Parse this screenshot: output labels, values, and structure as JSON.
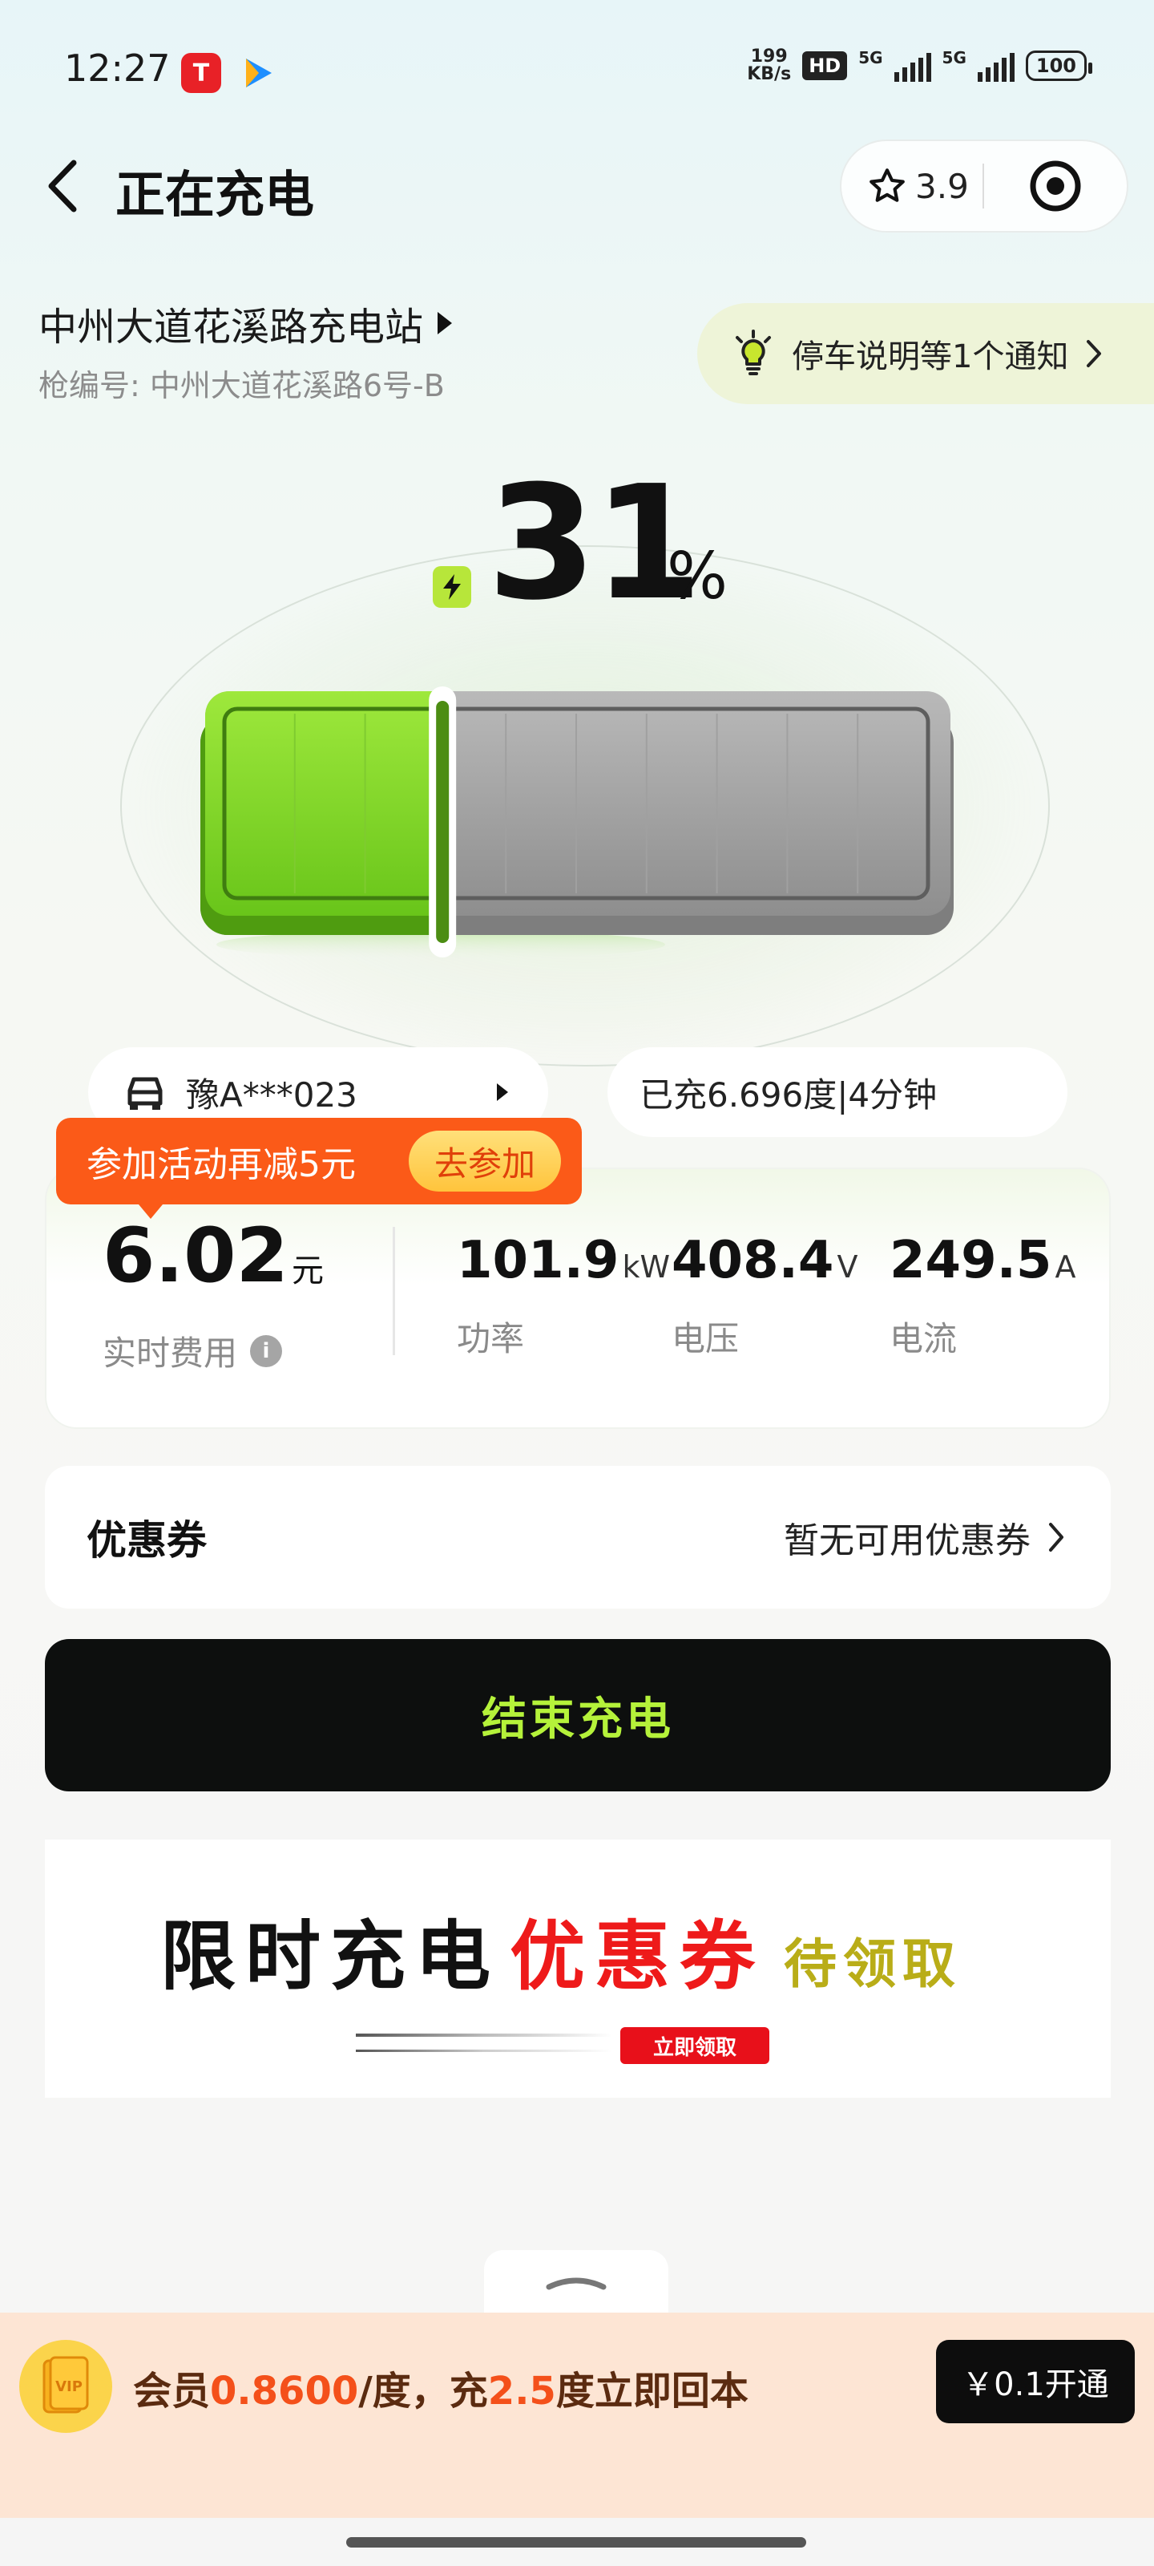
{
  "status_bar": {
    "time": "12:27",
    "tesla_label": "T",
    "net_speed_top": "199",
    "net_speed_bottom": "KB/s",
    "hd_label": "HD",
    "signal_1": "5G",
    "signal_2": "5G",
    "battery": "100"
  },
  "header": {
    "title": "正在充电",
    "rating": "3.9"
  },
  "station": {
    "name": "中州大道花溪路充电站",
    "gun_number": "枪编号: 中州大道花溪路6号-B",
    "notice": "停车说明等1个通知"
  },
  "charge": {
    "percent": "31",
    "percent_sign": "%",
    "level": 0.31
  },
  "info": {
    "plate": "豫A***023",
    "charged": "已充6.696度|4分钟"
  },
  "promo": {
    "text": "参加活动再减5元",
    "button": "去参加"
  },
  "fee": {
    "value": "6.02",
    "unit": "元",
    "label": "实时费用"
  },
  "metrics": [
    {
      "value": "101.9",
      "unit": "kW",
      "label": "功率"
    },
    {
      "value": "408.4",
      "unit": "V",
      "label": "电压"
    },
    {
      "value": "249.5",
      "unit": "A",
      "label": "电流"
    }
  ],
  "coupon": {
    "title": "优惠券",
    "value": "暂无可用优惠券"
  },
  "end_button": "结束充电",
  "banner": {
    "part1": "限时充电",
    "part2": "优惠券",
    "part3": "待领取",
    "button": "立即领取"
  },
  "member": {
    "prefix": "会员",
    "price": "0.8600",
    "mid": "/度，充",
    "amount": "2.5",
    "suffix": "度立即回本",
    "button": "￥0.1开通"
  },
  "colors": {
    "accent_green": "#b5f23a",
    "promo_orange": "#fb5a18",
    "banner_red": "#ee1a1a",
    "member_bg": "#fde5d4"
  }
}
